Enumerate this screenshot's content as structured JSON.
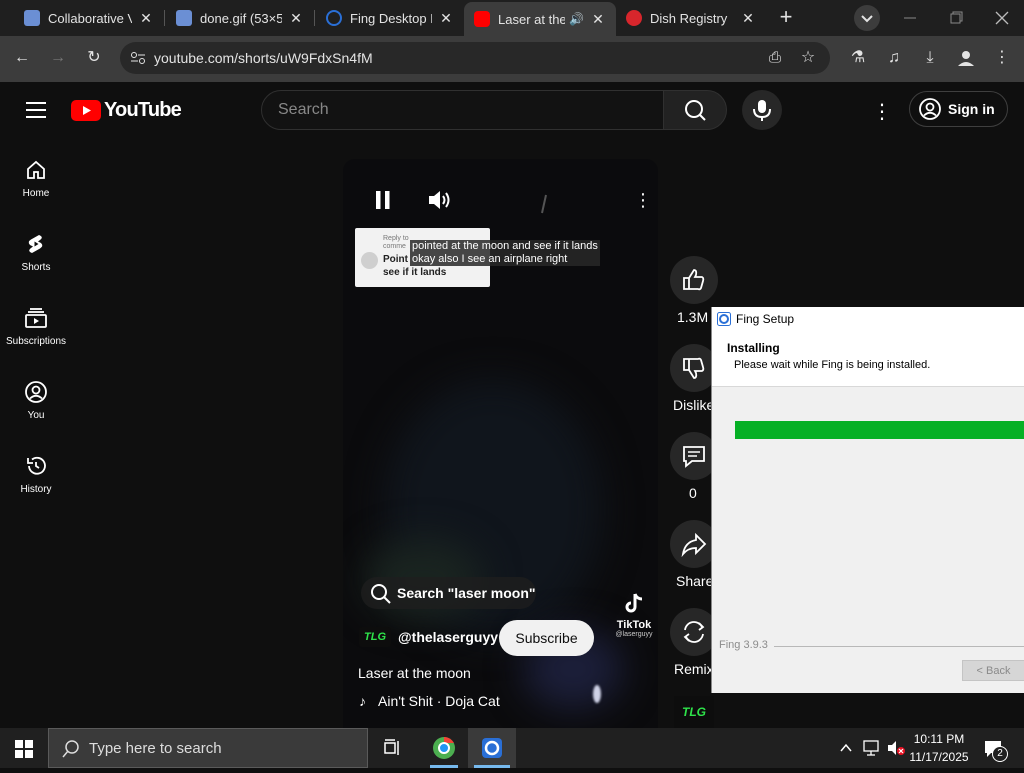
{
  "browser": {
    "tabs": [
      {
        "title": "Collaborative V",
        "favicon_color": "#6b8fd4"
      },
      {
        "title": "done.gif (53×5",
        "favicon_color": "#6b8fd4"
      },
      {
        "title": "Fing Desktop D",
        "favicon_color": "#1b4fa0"
      },
      {
        "title": "Laser at the",
        "favicon_color": "#ff0000"
      },
      {
        "title": "Dish Registry",
        "favicon_color": "#d7262c"
      }
    ],
    "url": "youtube.com/shorts/uW9FdxSn4fM"
  },
  "youtube": {
    "logo_text": "YouTube",
    "search_placeholder": "Search",
    "sign_in": "Sign in",
    "sidebar": [
      {
        "label": "Home"
      },
      {
        "label": "Shorts"
      },
      {
        "label": "Subscriptions"
      },
      {
        "label": "You"
      },
      {
        "label": "History"
      }
    ],
    "comment": {
      "reply_to": "Reply to",
      "commenter": "comme",
      "text_l1": "Point",
      "text_l2": "see if it lands"
    },
    "overlay_caption": {
      "line1": "pointed at the moon and see if it lands",
      "line2": "okay also I see an airplane right"
    },
    "search_suggestion": "Search \"laser moon\"",
    "tiktok": {
      "name": "TikTok",
      "handle": "@laserguyy"
    },
    "channel": {
      "badge": "TLG",
      "handle": "@thelaserguyy"
    },
    "subscribe": "Subscribe",
    "video_title": "Laser at the moon",
    "music": "Ain't Shit · Doja Cat",
    "actions": {
      "likes": "1.3M",
      "dislike": "Dislike",
      "comments": "0",
      "share": "Share",
      "remix": "Remix"
    }
  },
  "fing_setup": {
    "title": "Fing Setup",
    "heading": "Installing",
    "subheading": "Please wait while Fing is being installed.",
    "progress_percent": 100,
    "version": "Fing 3.9.3",
    "back_button": "< Back",
    "accent": "#06b025"
  },
  "taskbar": {
    "search_placeholder": "Type here to search",
    "time": "10:11 PM",
    "date": "11/17/2025",
    "notifications": "2"
  }
}
